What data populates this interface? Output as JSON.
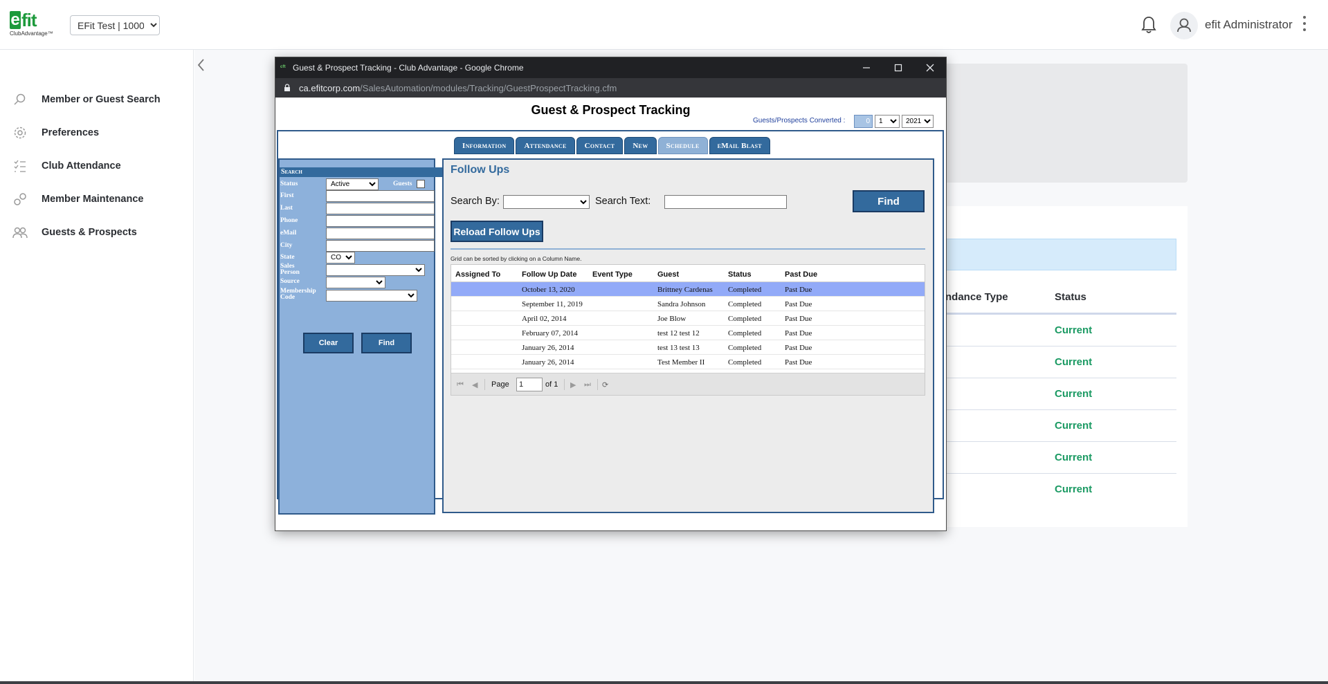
{
  "app": {
    "logo": {
      "mark_e": "e",
      "mark_fit": "fit",
      "sub": "ClubAdvantage™"
    },
    "club_select": "EFit Test | 1000",
    "user_name": "efit Administrator",
    "nav": [
      {
        "label": "Member or Guest Search",
        "icon": "search-icon"
      },
      {
        "label": "Preferences",
        "icon": "gear-icon"
      },
      {
        "label": "Club Attendance",
        "icon": "checklist-icon"
      },
      {
        "label": "Member Maintenance",
        "icon": "link-icon"
      },
      {
        "label": "Guests & Prospects",
        "icon": "people-icon"
      }
    ],
    "background_table": {
      "headers": [
        "ndance Type",
        "Status"
      ],
      "rows": [
        "Current",
        "Current",
        "Current",
        "Current",
        "Current",
        "Current"
      ],
      "status_color": "#1b9a63"
    }
  },
  "popup": {
    "window_title": "Guest & Prospect Tracking - Club Advantage - Google Chrome",
    "url_host": "ca.efitcorp.com",
    "url_path": "/SalesAutomation/modules/Tracking/GuestProspectTracking.cfm",
    "page_title": "Guest & Prospect Tracking",
    "converted_label": "Guests/Prospects Converted :",
    "converted_value": "0",
    "month_select": "1",
    "year_select": "2021",
    "tabs": [
      {
        "label": "Information",
        "active": false
      },
      {
        "label": "Attendance",
        "active": false
      },
      {
        "label": "Contact",
        "active": false
      },
      {
        "label": "New",
        "active": false
      },
      {
        "label": "Schedule",
        "active": true
      },
      {
        "label": "eMail Blast",
        "active": false
      }
    ],
    "search": {
      "header": "Search",
      "status_label": "Status",
      "status_value": "Active",
      "guests_label": "Guests",
      "first_label": "First",
      "last_label": "Last",
      "phone_label": "Phone",
      "email_label": "eMail",
      "city_label": "City",
      "state_label": "State",
      "state_value": "CO",
      "sales_label_1": "Sales",
      "sales_label_2": "Person",
      "source_label": "Source",
      "membership_label_1": "Membership",
      "membership_label_2": "Code",
      "clear_button": "Clear",
      "find_button": "Find"
    },
    "followups": {
      "title": "Follow Ups",
      "search_by_label": "Search By:",
      "search_text_label": "Search Text:",
      "find_button": "Find",
      "reload_button": "Reload Follow Ups",
      "hint": "Grid can be sorted by clicking on a Column Name.",
      "columns": [
        "Assigned To",
        "Follow Up Date",
        "Event Type",
        "Guest",
        "Status",
        "Past Due"
      ],
      "rows": [
        {
          "assigned": "",
          "date": "October 13, 2020",
          "event": "",
          "guest": "Brittney Cardenas",
          "status": "Completed",
          "past_due": "Past Due"
        },
        {
          "assigned": "",
          "date": "September 11, 2019",
          "event": "",
          "guest": "Sandra Johnson",
          "status": "Completed",
          "past_due": "Past Due"
        },
        {
          "assigned": "",
          "date": "April 02, 2014",
          "event": "",
          "guest": "Joe Blow",
          "status": "Completed",
          "past_due": "Past Due"
        },
        {
          "assigned": "",
          "date": "February 07, 2014",
          "event": "",
          "guest": "test 12 test 12",
          "status": "Completed",
          "past_due": "Past Due"
        },
        {
          "assigned": "",
          "date": "January 26, 2014",
          "event": "",
          "guest": "test 13 test 13",
          "status": "Completed",
          "past_due": "Past Due"
        },
        {
          "assigned": "",
          "date": "January 26, 2014",
          "event": "",
          "guest": "Test Member II",
          "status": "Completed",
          "past_due": "Past Due"
        }
      ],
      "pager": {
        "page_label": "Page",
        "page_value": "1",
        "of_label": "of 1"
      }
    }
  }
}
